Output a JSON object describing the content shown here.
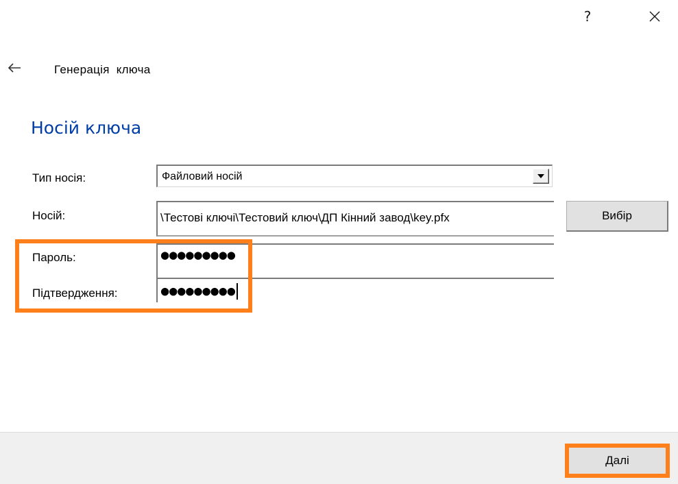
{
  "titlebar": {
    "help_glyph": "?",
    "close_icon": "close-icon"
  },
  "header": {
    "back_icon": "arrow-left-icon",
    "title": "Генерація  ключа"
  },
  "section": {
    "heading": "Носій ключа"
  },
  "form": {
    "media_type_label": "Тип носія:",
    "media_type_value": "Файловий носій",
    "media_label": "Носій:",
    "media_value": "\\Тестові ключі\\Тестовий ключ\\ДП Кінний завод\\key.pfx",
    "choose_button_label": "Вибір",
    "password_label": "Пароль:",
    "password_value": "●●●●●●●●●",
    "confirm_label": "Підтвердження:",
    "confirm_value": "●●●●●●●●●"
  },
  "footer": {
    "next_button_label": "Далі"
  },
  "colors": {
    "accent_heading": "#003da5",
    "highlight": "#ff7f1a",
    "footer_bg": "#f0f0f0"
  }
}
